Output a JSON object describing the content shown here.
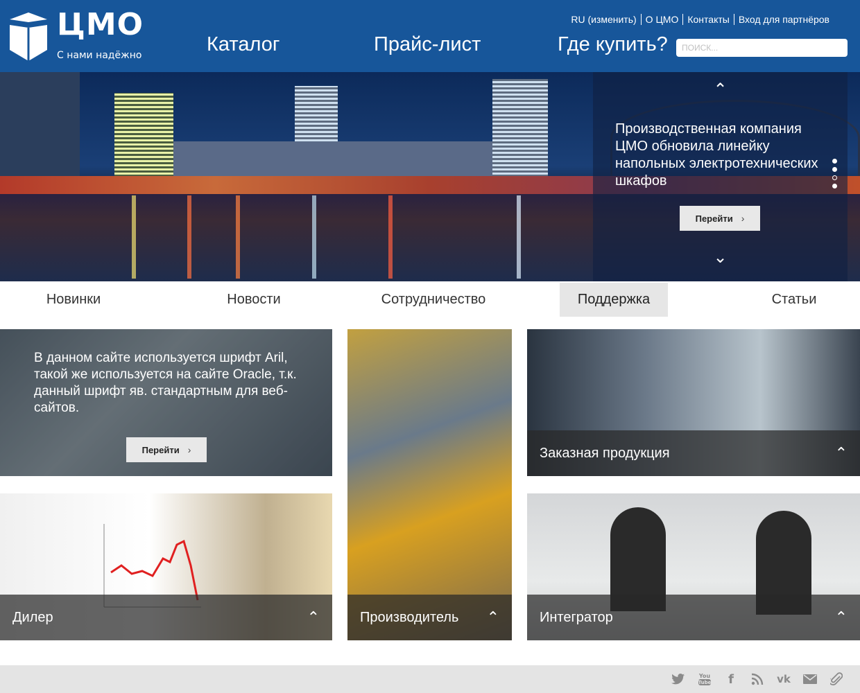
{
  "header": {
    "logo_text": "ЦМО",
    "slogan": "С нами надёжно",
    "nav": [
      "Каталог",
      "Прайс-лист",
      "Где купить?"
    ],
    "top_links": [
      "RU (изменить)",
      "О ЦМО",
      "Контакты",
      "Вход для партнёров"
    ],
    "search_placeholder": "поиск..."
  },
  "hero": {
    "title": "Производственная компания ЦМО обновила линейку напольных электротехнических шкафов",
    "button": "Перейти",
    "slides_total": 4,
    "active_slide": 3
  },
  "subnav": {
    "items": [
      "Новинки",
      "Новости",
      "Сотрудничество",
      "Поддержка",
      "Статьи"
    ],
    "active": "Поддержка"
  },
  "tiles": {
    "promo_text": "В данном сайте используется шрифт Aril, такой же используется на сайте Oracle, т.к. данный шрифт яв. стандартным для веб-сайтов.",
    "promo_button": "Перейти",
    "custom": "Заказная продукция",
    "dealer": "Дилер",
    "producer": "Производитель",
    "integrator": "Интегратор"
  },
  "footer": {
    "social_icons": [
      "twitter-icon",
      "youtube-icon",
      "facebook-icon",
      "rss-icon",
      "vk-icon",
      "mail-icon",
      "attach-icon"
    ]
  },
  "colors": {
    "header_bg": "#17569a",
    "subnav_active_bg": "#e6e6e6",
    "footer_bg": "#e4e4e4"
  }
}
